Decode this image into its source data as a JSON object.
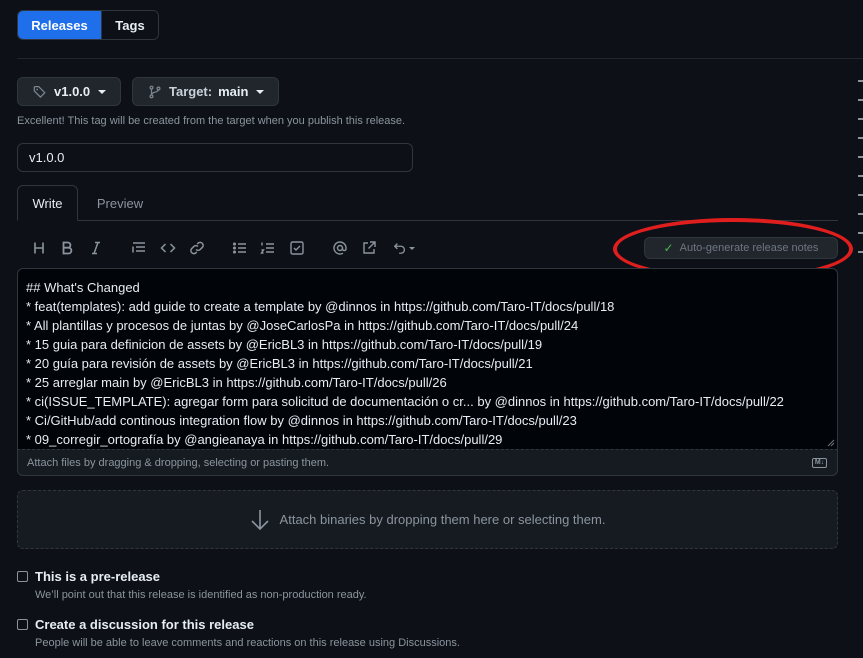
{
  "tabs": {
    "releases": "Releases",
    "tags": "Tags"
  },
  "tag_button": {
    "label": "v1.0.0"
  },
  "target_button": {
    "prefix": "Target:",
    "value": "main"
  },
  "hint": "Excellent! This tag will be created from the target when you publish this release.",
  "title_input": {
    "value": "v1.0.0"
  },
  "editor_tabs": {
    "write": "Write",
    "preview": "Preview"
  },
  "autogen_label": "Auto-generate release notes",
  "editor_lines": [
    "## What's Changed",
    "* feat(templates): add guide to create a template by @dinnos in https://github.com/Taro-IT/docs/pull/18",
    "* All plantillas y procesos de juntas by @JoseCarlosPa in https://github.com/Taro-IT/docs/pull/24",
    "* 15 guia para definicion de assets by @EricBL3 in https://github.com/Taro-IT/docs/pull/19",
    "* 20 guía para revisión de assets by @EricBL3 in https://github.com/Taro-IT/docs/pull/21",
    "* 25 arreglar main by @EricBL3 in https://github.com/Taro-IT/docs/pull/26",
    "* ci(ISSUE_TEMPLATE): agregar form para solicitud de documentación o cr... by @dinnos in https://github.com/Taro-IT/docs/pull/22",
    "* Ci/GitHub/add continous integration flow by @dinnos in https://github.com/Taro-IT/docs/pull/23",
    "* 09_corregir_ortografía by @angieanaya in https://github.com/Taro-IT/docs/pull/29"
  ],
  "attach_files": "Attach files by dragging & dropping, selecting or pasting them.",
  "attach_binaries": "Attach binaries by dropping them here or selecting them.",
  "prerelease": {
    "label": "This is a pre-release",
    "desc": "We’ll point out that this release is identified as non-production ready."
  },
  "discussion": {
    "label": "Create a discussion for this release",
    "desc": "People will be able to leave comments and reactions on this release using Discussions."
  }
}
